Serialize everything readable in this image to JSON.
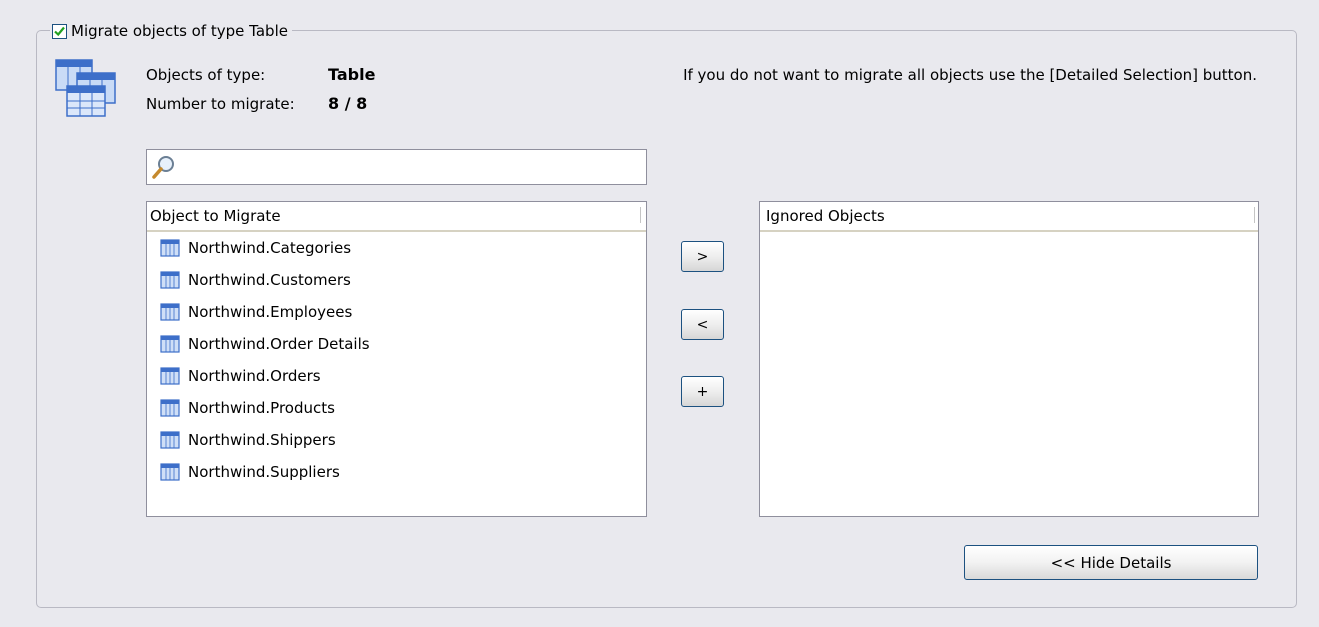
{
  "group": {
    "checked": true,
    "title": "Migrate objects of type Table"
  },
  "info": {
    "type_label": "Objects of type:",
    "type_value": "Table",
    "count_label": "Number to migrate:",
    "count_value": "8 / 8",
    "hint": "If you do not want to migrate all objects use the [Detailed Selection] button."
  },
  "search": {
    "value": "",
    "placeholder": ""
  },
  "migrate_list": {
    "header": "Object to Migrate",
    "items": [
      "Northwind.Categories",
      "Northwind.Customers",
      "Northwind.Employees",
      "Northwind.Order Details",
      "Northwind.Orders",
      "Northwind.Products",
      "Northwind.Shippers",
      "Northwind.Suppliers"
    ]
  },
  "ignored_list": {
    "header": "Ignored Objects",
    "items": []
  },
  "buttons": {
    "move_right": ">",
    "move_left": "<",
    "add": "+",
    "hide_details": "<< Hide Details"
  },
  "icons": {
    "checkbox": "checkmark-icon",
    "type": "table-stack-icon",
    "search": "magnifier-icon",
    "row": "table-icon"
  },
  "colors": {
    "background": "#e9e9ee",
    "button_border": "#1c5180",
    "checkmark": "#21a121",
    "table_icon": "#3d6fc9"
  }
}
